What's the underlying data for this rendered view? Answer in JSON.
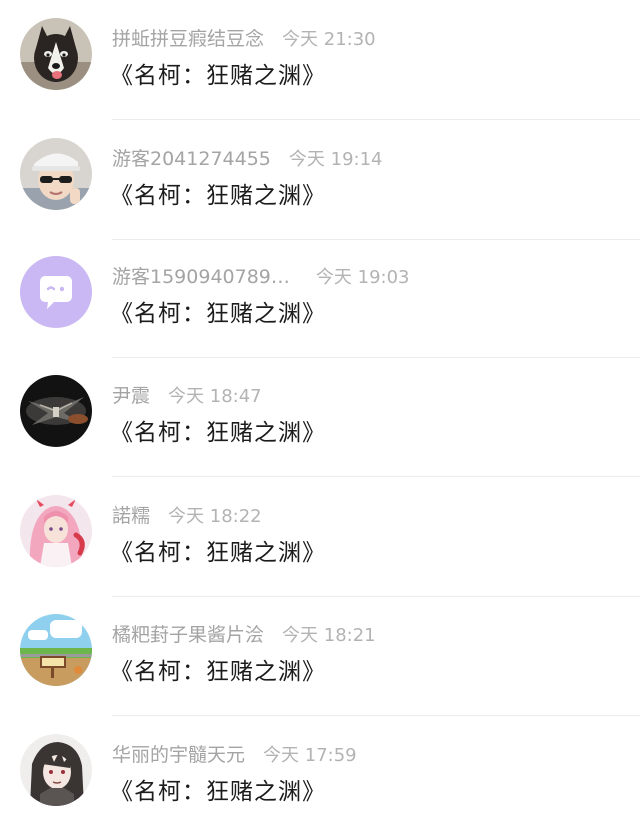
{
  "messages": [
    {
      "name": "拼蚯拼豆瘕结豆念",
      "time": "今天 21:30",
      "text": "《名柯：狂赌之渊》",
      "avatar_icon": "husky-dog-avatar"
    },
    {
      "name": "游客2041274455",
      "time": "今天 19:14",
      "text": "《名柯：狂赌之渊》",
      "avatar_icon": "cap-sunglasses-person-avatar"
    },
    {
      "name": "游客1590940789…",
      "time": "今天 19:03",
      "text": "《名柯：狂赌之渊》",
      "avatar_icon": "purple-chat-bubble-avatar"
    },
    {
      "name": "尹震",
      "time": "今天 18:47",
      "text": "《名柯：狂赌之渊》",
      "avatar_icon": "dark-mecha-avatar"
    },
    {
      "name": "諾糯",
      "time": "今天 18:22",
      "text": "《名柯：狂赌之渊》",
      "avatar_icon": "pink-anime-girl-avatar"
    },
    {
      "name": "橘粑葑子果酱片浍",
      "time": "今天 18:21",
      "text": "《名柯：狂赌之渊》",
      "avatar_icon": "cartoon-landscape-avatar"
    },
    {
      "name": "华丽的宇髓天元",
      "time": "今天 17:59",
      "text": "《名柯：狂赌之渊》",
      "avatar_icon": "anime-character-avatar"
    }
  ],
  "colors": {
    "name": "#a4a4a4",
    "time": "#b3b3b3",
    "message": "#1c1c1c",
    "divider": "#ececec",
    "purple_avatar": "#c9b8f3"
  }
}
